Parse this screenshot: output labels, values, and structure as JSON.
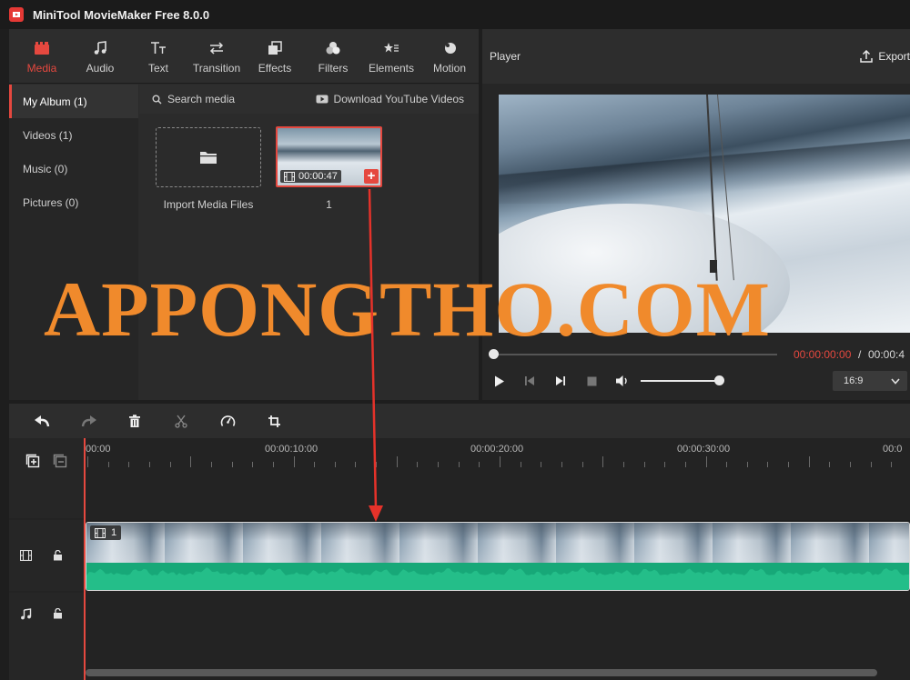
{
  "app": {
    "title": "MiniTool MovieMaker Free 8.0.0"
  },
  "toolbar": {
    "tabs": [
      {
        "label": "Media",
        "icon": "media-icon"
      },
      {
        "label": "Audio",
        "icon": "music-note-icon"
      },
      {
        "label": "Text",
        "icon": "text-icon"
      },
      {
        "label": "Transition",
        "icon": "transition-icon"
      },
      {
        "label": "Effects",
        "icon": "effects-icon"
      },
      {
        "label": "Filters",
        "icon": "filters-icon"
      },
      {
        "label": "Elements",
        "icon": "elements-icon"
      },
      {
        "label": "Motion",
        "icon": "motion-icon"
      }
    ],
    "active": "Media",
    "accent_color": "#e5483f"
  },
  "sidebar": {
    "items": [
      {
        "label": "My Album (1)"
      },
      {
        "label": "Videos (1)"
      },
      {
        "label": "Music (0)"
      },
      {
        "label": "Pictures (0)"
      }
    ]
  },
  "media": {
    "search_placeholder": "Search media",
    "youtube_label": "Download YouTube Videos",
    "import_label": "Import Media Files",
    "clip": {
      "duration": "00:00:47",
      "label": "1",
      "add_symbol": "+"
    }
  },
  "player": {
    "title": "Player",
    "export_label": "Export",
    "time_current": "00:00:00:00",
    "time_sep": "/",
    "time_total": "00:00:4",
    "aspect_ratio": "16:9",
    "seek_progress": 0,
    "volume_level": 1.0
  },
  "timeline": {
    "ruler": [
      "00:00",
      "00:00:10:00",
      "00:00:20:00",
      "00:00:30:00",
      "00:0"
    ],
    "clip_tag": "1",
    "waveform_color": "#17a878"
  },
  "watermark": {
    "text": "APPONGTHO.COM",
    "color": "#f08a2c"
  }
}
